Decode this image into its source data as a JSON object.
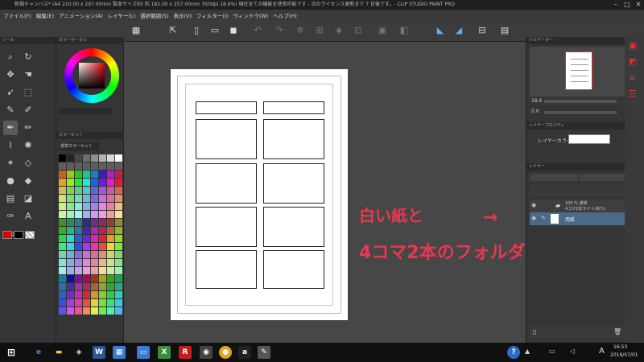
{
  "window": {
    "title": "新規キャンバス* (A4 210.00 x 297.00mm 製本サイズB5 判 182.00 x 257.00mm 350dpi 18.6%)  現在全ての機能を使用可能です - 次のライセンス更新まで 7 日後です。- CLIP STUDIO PAINT PRO"
  },
  "menu": [
    "ファイル(F)",
    "編集(E)",
    "アニメーション(A)",
    "レイヤー(L)",
    "選択範囲(S)",
    "表示(V)",
    "フィルター(I)",
    "ウィンドウ(W)",
    "ヘルプ(H)"
  ],
  "panels": {
    "tool": "ツール",
    "sub_tool": "サブツール",
    "color_circle": "カラーサークル",
    "color_set": "カラーセット",
    "color_set_name": "標準カラーセット",
    "navigator": "ナビゲーター",
    "zoom_value": "18.6",
    "rotate_value": "0.0",
    "layer_property": "レイヤープロパティ",
    "layer_color_label": "レイヤーカラー",
    "layer": "レイヤー"
  },
  "layers": [
    {
      "line1": "100 % 通常",
      "line2": "4コマ2本ライト(あり)"
    },
    {
      "line1": "用紙",
      "line2": ""
    }
  ],
  "annotation": {
    "line1": "白い紙と",
    "line2": "4コマ2本のフォルダ",
    "arrow": "→",
    "color": "#e8384f"
  },
  "statusbar": {
    "zoom": "18.6"
  },
  "taskbar": {
    "time": "16:53",
    "date": "2016/07/01",
    "ime": "A"
  },
  "colors": {
    "accent_red": "#e8384f",
    "selection_blue": "#4a6a8a"
  }
}
